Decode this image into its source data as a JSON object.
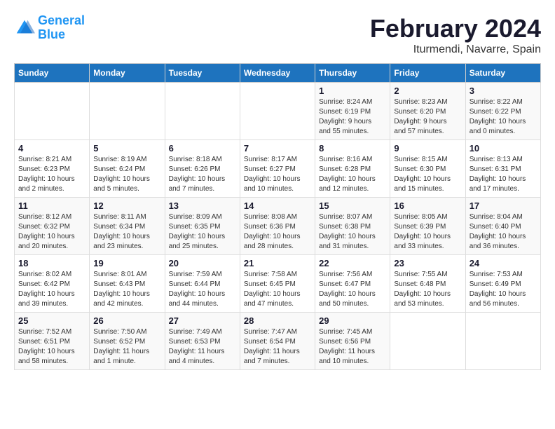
{
  "header": {
    "logo_line1": "General",
    "logo_line2": "Blue",
    "month_year": "February 2024",
    "location": "Iturmendi, Navarre, Spain"
  },
  "weekdays": [
    "Sunday",
    "Monday",
    "Tuesday",
    "Wednesday",
    "Thursday",
    "Friday",
    "Saturday"
  ],
  "weeks": [
    [
      {
        "day": "",
        "info": ""
      },
      {
        "day": "",
        "info": ""
      },
      {
        "day": "",
        "info": ""
      },
      {
        "day": "",
        "info": ""
      },
      {
        "day": "1",
        "info": "Sunrise: 8:24 AM\nSunset: 6:19 PM\nDaylight: 9 hours\nand 55 minutes."
      },
      {
        "day": "2",
        "info": "Sunrise: 8:23 AM\nSunset: 6:20 PM\nDaylight: 9 hours\nand 57 minutes."
      },
      {
        "day": "3",
        "info": "Sunrise: 8:22 AM\nSunset: 6:22 PM\nDaylight: 10 hours\nand 0 minutes."
      }
    ],
    [
      {
        "day": "4",
        "info": "Sunrise: 8:21 AM\nSunset: 6:23 PM\nDaylight: 10 hours\nand 2 minutes."
      },
      {
        "day": "5",
        "info": "Sunrise: 8:19 AM\nSunset: 6:24 PM\nDaylight: 10 hours\nand 5 minutes."
      },
      {
        "day": "6",
        "info": "Sunrise: 8:18 AM\nSunset: 6:26 PM\nDaylight: 10 hours\nand 7 minutes."
      },
      {
        "day": "7",
        "info": "Sunrise: 8:17 AM\nSunset: 6:27 PM\nDaylight: 10 hours\nand 10 minutes."
      },
      {
        "day": "8",
        "info": "Sunrise: 8:16 AM\nSunset: 6:28 PM\nDaylight: 10 hours\nand 12 minutes."
      },
      {
        "day": "9",
        "info": "Sunrise: 8:15 AM\nSunset: 6:30 PM\nDaylight: 10 hours\nand 15 minutes."
      },
      {
        "day": "10",
        "info": "Sunrise: 8:13 AM\nSunset: 6:31 PM\nDaylight: 10 hours\nand 17 minutes."
      }
    ],
    [
      {
        "day": "11",
        "info": "Sunrise: 8:12 AM\nSunset: 6:32 PM\nDaylight: 10 hours\nand 20 minutes."
      },
      {
        "day": "12",
        "info": "Sunrise: 8:11 AM\nSunset: 6:34 PM\nDaylight: 10 hours\nand 23 minutes."
      },
      {
        "day": "13",
        "info": "Sunrise: 8:09 AM\nSunset: 6:35 PM\nDaylight: 10 hours\nand 25 minutes."
      },
      {
        "day": "14",
        "info": "Sunrise: 8:08 AM\nSunset: 6:36 PM\nDaylight: 10 hours\nand 28 minutes."
      },
      {
        "day": "15",
        "info": "Sunrise: 8:07 AM\nSunset: 6:38 PM\nDaylight: 10 hours\nand 31 minutes."
      },
      {
        "day": "16",
        "info": "Sunrise: 8:05 AM\nSunset: 6:39 PM\nDaylight: 10 hours\nand 33 minutes."
      },
      {
        "day": "17",
        "info": "Sunrise: 8:04 AM\nSunset: 6:40 PM\nDaylight: 10 hours\nand 36 minutes."
      }
    ],
    [
      {
        "day": "18",
        "info": "Sunrise: 8:02 AM\nSunset: 6:42 PM\nDaylight: 10 hours\nand 39 minutes."
      },
      {
        "day": "19",
        "info": "Sunrise: 8:01 AM\nSunset: 6:43 PM\nDaylight: 10 hours\nand 42 minutes."
      },
      {
        "day": "20",
        "info": "Sunrise: 7:59 AM\nSunset: 6:44 PM\nDaylight: 10 hours\nand 44 minutes."
      },
      {
        "day": "21",
        "info": "Sunrise: 7:58 AM\nSunset: 6:45 PM\nDaylight: 10 hours\nand 47 minutes."
      },
      {
        "day": "22",
        "info": "Sunrise: 7:56 AM\nSunset: 6:47 PM\nDaylight: 10 hours\nand 50 minutes."
      },
      {
        "day": "23",
        "info": "Sunrise: 7:55 AM\nSunset: 6:48 PM\nDaylight: 10 hours\nand 53 minutes."
      },
      {
        "day": "24",
        "info": "Sunrise: 7:53 AM\nSunset: 6:49 PM\nDaylight: 10 hours\nand 56 minutes."
      }
    ],
    [
      {
        "day": "25",
        "info": "Sunrise: 7:52 AM\nSunset: 6:51 PM\nDaylight: 10 hours\nand 58 minutes."
      },
      {
        "day": "26",
        "info": "Sunrise: 7:50 AM\nSunset: 6:52 PM\nDaylight: 11 hours\nand 1 minute."
      },
      {
        "day": "27",
        "info": "Sunrise: 7:49 AM\nSunset: 6:53 PM\nDaylight: 11 hours\nand 4 minutes."
      },
      {
        "day": "28",
        "info": "Sunrise: 7:47 AM\nSunset: 6:54 PM\nDaylight: 11 hours\nand 7 minutes."
      },
      {
        "day": "29",
        "info": "Sunrise: 7:45 AM\nSunset: 6:56 PM\nDaylight: 11 hours\nand 10 minutes."
      },
      {
        "day": "",
        "info": ""
      },
      {
        "day": "",
        "info": ""
      }
    ]
  ]
}
